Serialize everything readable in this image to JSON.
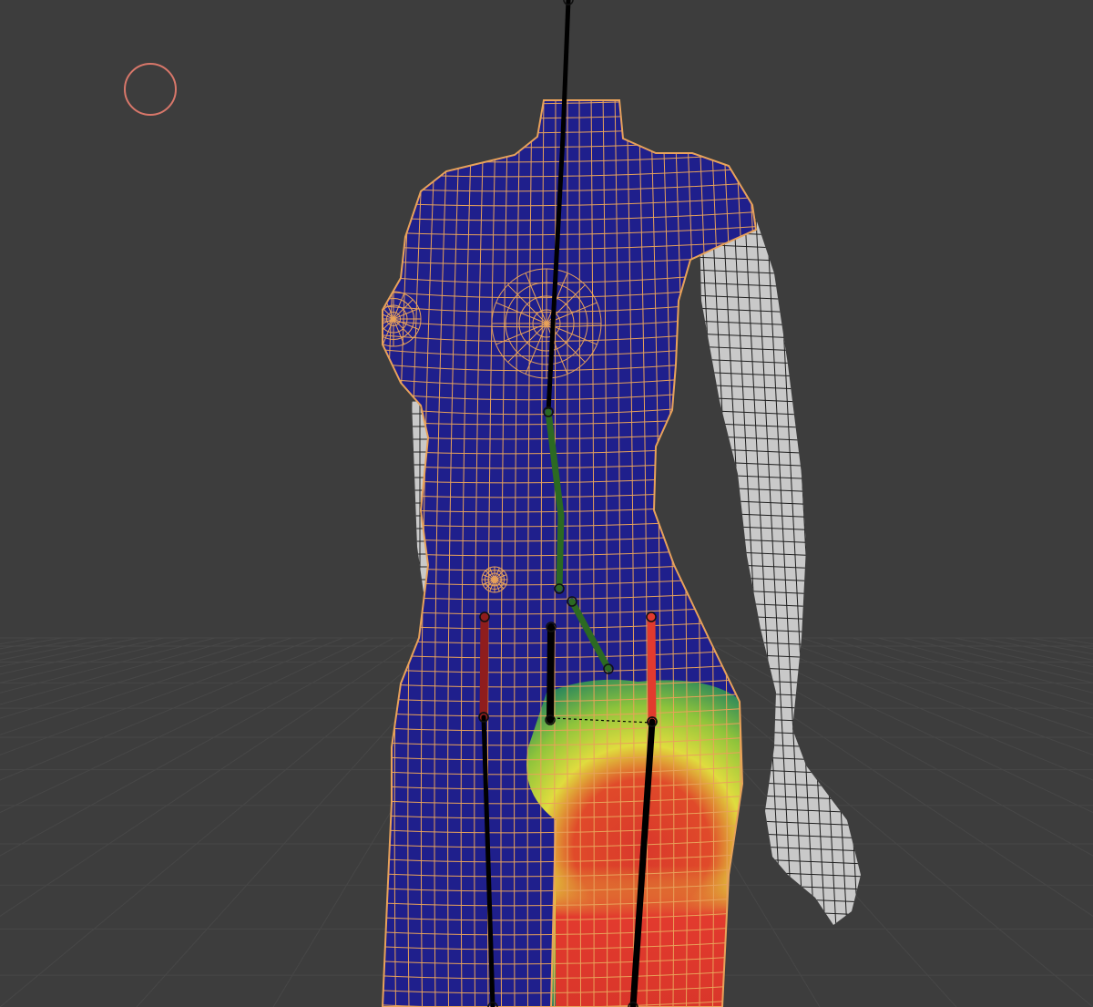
{
  "viewport": {
    "mode": "weight-paint",
    "background_color": "#3d3d3d",
    "floor_grid_color": "#474747"
  },
  "brush_cursor": {
    "color": "#d8776a"
  },
  "mesh": {
    "wire_color": "#e8a25a",
    "base_weight_color": "#1f1f8c",
    "unselected_wire_color": "#1e1e1e",
    "unselected_fill_color": "#c9c9c9",
    "weight_gradient": [
      "#1f1f8c",
      "#2f8a5a",
      "#8fc43b",
      "#e0dc3e",
      "#e8a23a",
      "#d9382b"
    ]
  },
  "armature": {
    "bones": [
      {
        "id": "spine-upper",
        "color": "#000000"
      },
      {
        "id": "spine",
        "color": "#2c6a22"
      },
      {
        "id": "pelvis",
        "color": "#2c6a22"
      },
      {
        "id": "thigh-left",
        "color": "#8f1d1d"
      },
      {
        "id": "thigh-center",
        "color": "#000000"
      },
      {
        "id": "thigh-right-active",
        "color": "#e23a2e"
      },
      {
        "id": "shin-left",
        "color": "#000000"
      },
      {
        "id": "shin-right",
        "color": "#000000"
      }
    ]
  }
}
